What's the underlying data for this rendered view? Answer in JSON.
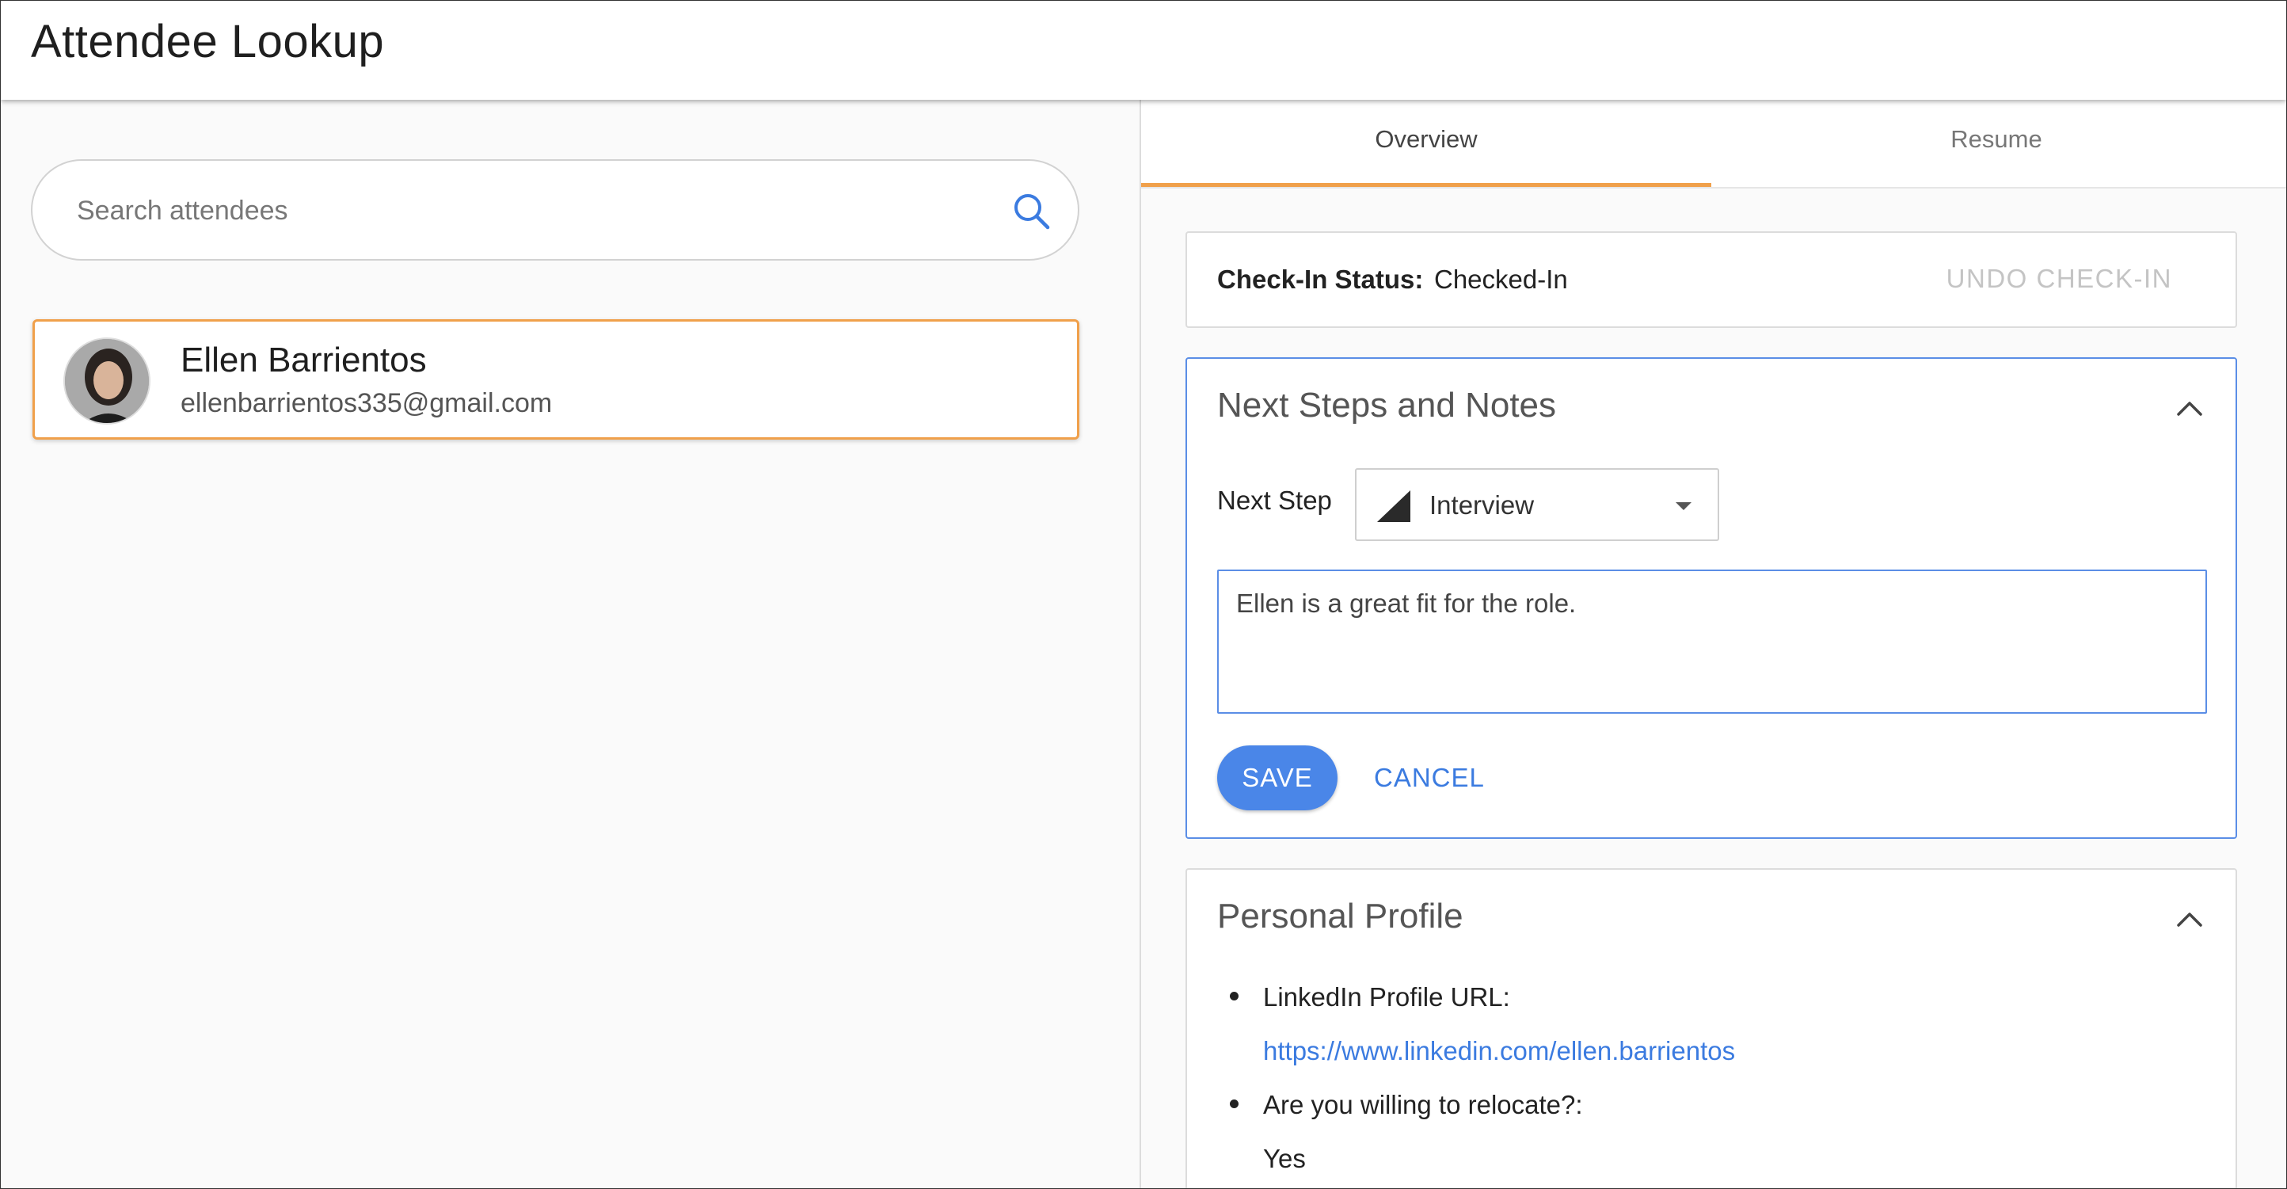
{
  "header": {
    "title": "Attendee Lookup"
  },
  "search": {
    "placeholder": "Search attendees"
  },
  "attendees": [
    {
      "name": "Ellen Barrientos",
      "email": "ellenbarrientos335@gmail.com"
    }
  ],
  "tabs": [
    {
      "label": "Overview",
      "active": true
    },
    {
      "label": "Resume",
      "active": false
    }
  ],
  "checkin": {
    "label": "Check-In Status:",
    "value": "Checked-In",
    "undo_label": "UNDO CHECK-IN"
  },
  "notes_section": {
    "title": "Next Steps and Notes",
    "next_step_label": "Next Step",
    "next_step_value": "Interview",
    "notes_text": "Ellen is a great fit for the role.",
    "save_label": "SAVE",
    "cancel_label": "CANCEL"
  },
  "profile": {
    "title": "Personal Profile",
    "items": [
      {
        "question": "LinkedIn Profile URL:",
        "answer": "https://www.linkedin.com/ellen.barrientos"
      },
      {
        "question": "Are you willing to relocate?:",
        "answer": "Yes"
      }
    ]
  },
  "colors": {
    "accent": "#f0a04b",
    "primary": "#4a86e8",
    "link": "#3b7be0"
  },
  "icons": {
    "search": "search-icon",
    "collapse": "chevron-up-icon",
    "dropdown": "caret-down-icon",
    "step_status": "signal-triangle-icon"
  }
}
